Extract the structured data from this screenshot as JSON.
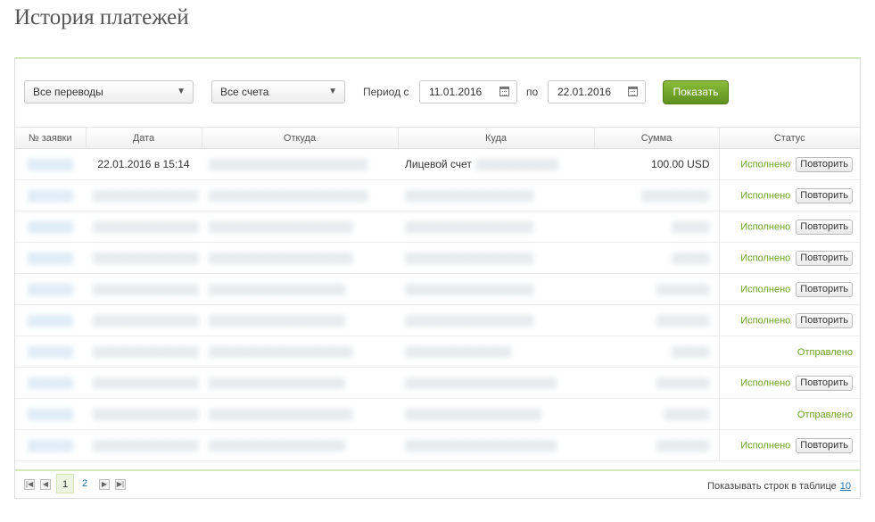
{
  "page": {
    "title": "История платежей"
  },
  "filters": {
    "transfer_type": "Все переводы",
    "accounts": "Все счета",
    "period_from_label": "Период с",
    "date_from": "11.01.2016",
    "period_to_label": "по",
    "date_to": "22.01.2016",
    "show_button": "Показать"
  },
  "table": {
    "headers": [
      "№ заявки",
      "Дата",
      "Откуда",
      "Куда",
      "Сумма",
      "Статус"
    ],
    "rows": [
      {
        "num": "▒▒▒▒▒▒",
        "date": "22.01.2016 в 15:14",
        "from": "▒▒▒▒▒▒▒▒▒▒▒▒▒▒▒▒▒▒▒▒▒",
        "to_prefix": "Лицевой счет",
        "to": "▒▒▒▒▒▒▒▒▒▒▒",
        "sum": "100.00 USD",
        "status": "Исполнено",
        "action": "Повторить"
      },
      {
        "num": "▒▒▒▒▒▒",
        "date": "▒▒▒▒▒▒▒▒▒▒▒▒▒▒",
        "from": "▒▒▒▒▒▒▒▒▒▒▒▒▒▒▒▒▒▒▒▒▒",
        "to_prefix": "",
        "to": "▒▒▒▒▒▒▒▒▒▒▒▒▒▒▒▒▒",
        "sum": "▒▒▒▒▒▒▒▒▒",
        "status": "Исполнено",
        "action": "Повторить"
      },
      {
        "num": "▒▒▒▒▒▒",
        "date": "▒▒▒▒▒▒▒▒▒▒▒▒▒▒",
        "from": "▒▒▒▒▒▒▒▒▒▒▒▒▒▒▒▒▒▒▒",
        "to_prefix": "",
        "to": "▒▒▒▒▒▒▒▒▒▒▒▒▒▒▒▒▒",
        "sum": "▒▒▒▒▒",
        "status": "Исполнено",
        "action": "Повторить"
      },
      {
        "num": "▒▒▒▒▒▒",
        "date": "▒▒▒▒▒▒▒▒▒▒▒▒▒▒",
        "from": "▒▒▒▒▒▒▒▒▒▒▒▒▒▒▒▒▒▒▒",
        "to_prefix": "",
        "to": "▒▒▒▒▒▒▒▒▒▒▒▒▒▒▒▒▒",
        "sum": "▒▒▒▒▒",
        "status": "Исполнено",
        "action": "Повторить"
      },
      {
        "num": "▒▒▒▒▒▒",
        "date": "▒▒▒▒▒▒▒▒▒▒▒▒▒▒",
        "from": "▒▒▒▒▒▒▒▒▒▒▒▒▒▒▒▒▒▒",
        "to_prefix": "",
        "to": "▒▒▒▒▒▒▒▒▒▒▒▒▒▒▒▒▒",
        "sum": "▒▒▒▒▒▒▒",
        "status": "Исполнено",
        "action": "Повторить"
      },
      {
        "num": "▒▒▒▒▒▒",
        "date": "▒▒▒▒▒▒▒▒▒▒▒▒▒▒",
        "from": "▒▒▒▒▒▒▒▒▒▒▒▒▒▒▒▒▒▒",
        "to_prefix": "",
        "to": "▒▒▒▒▒▒▒▒▒▒▒▒▒▒▒▒▒",
        "sum": "▒▒▒▒▒▒▒",
        "status": "Исполнено",
        "action": "Повторить"
      },
      {
        "num": "▒▒▒▒▒▒",
        "date": "▒▒▒▒▒▒▒▒▒▒▒▒▒▒",
        "from": "▒▒▒▒▒▒▒▒▒▒▒▒▒▒▒▒▒▒▒",
        "to_prefix": "",
        "to": "▒▒▒▒▒▒▒▒▒▒▒▒▒▒",
        "sum": "▒▒▒▒▒",
        "status": "Отправлено",
        "action": ""
      },
      {
        "num": "▒▒▒▒▒▒",
        "date": "▒▒▒▒▒▒▒▒▒▒▒▒▒▒",
        "from": "▒▒▒▒▒▒▒▒▒▒▒▒▒▒▒▒▒▒",
        "to_prefix": "",
        "to": "▒▒▒▒▒▒▒▒▒▒▒▒▒▒▒▒▒▒▒▒",
        "sum": "▒▒▒▒▒▒▒",
        "status": "Исполнено",
        "action": "Повторить"
      },
      {
        "num": "▒▒▒▒▒▒",
        "date": "▒▒▒▒▒▒▒▒▒▒▒▒▒▒",
        "from": "▒▒▒▒▒▒▒▒▒▒▒▒▒▒▒▒▒▒▒",
        "to_prefix": "",
        "to": "▒▒▒▒▒▒▒▒▒▒▒▒▒▒▒▒▒▒",
        "sum": "▒▒▒▒▒▒",
        "status": "Отправлено",
        "action": ""
      },
      {
        "num": "▒▒▒▒▒▒",
        "date": "▒▒▒▒▒▒▒▒▒▒▒▒▒▒",
        "from": "▒▒▒▒▒▒▒▒▒▒▒▒▒▒▒▒▒▒",
        "to_prefix": "",
        "to": "▒▒▒▒▒▒▒▒▒▒▒▒▒▒▒▒▒▒▒▒",
        "sum": "▒▒▒▒▒▒▒",
        "status": "Исполнено",
        "action": "Повторить"
      }
    ]
  },
  "pagination": {
    "first_icon": "first-page-icon",
    "prev_icon": "prev-page-icon",
    "next_icon": "next-page-icon",
    "last_icon": "last-page-icon",
    "pages": [
      "1",
      "2"
    ],
    "current_page": "1",
    "rows_label": "Показывать строк в таблице",
    "rows_value": "10"
  },
  "colors": {
    "accent_green": "#6aa121",
    "button_green": "#6f9f2a",
    "link_blue": "#1d6fae"
  }
}
